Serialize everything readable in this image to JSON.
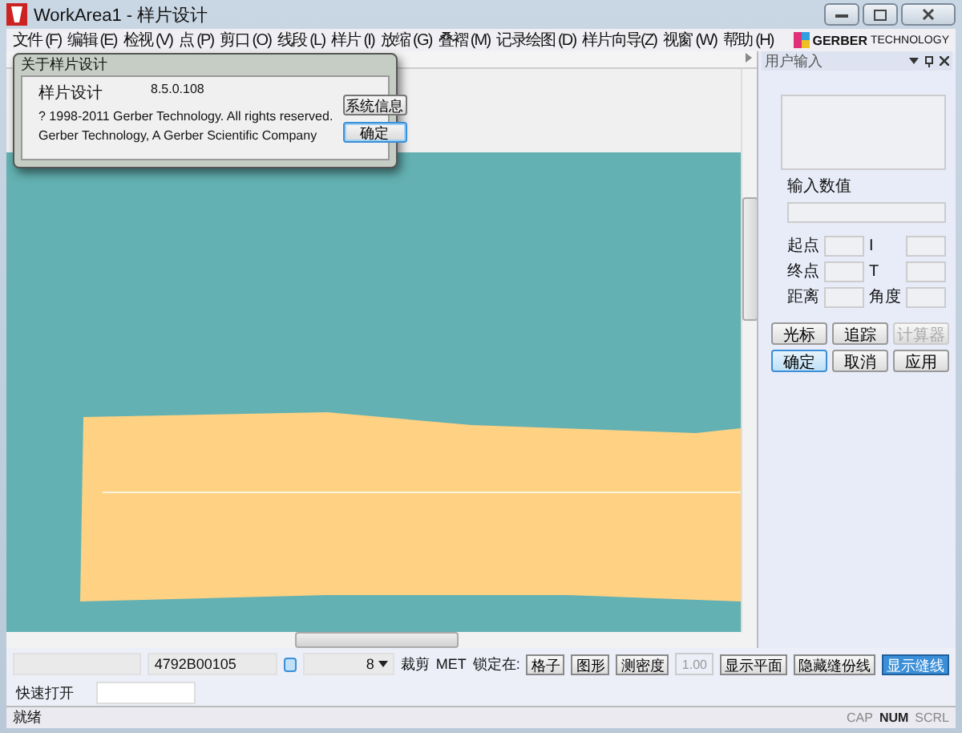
{
  "window": {
    "title": "WorkArea1 - 样片设计"
  },
  "menu": [
    "文件 (F)",
    "编辑 (E)",
    "检视 (V)",
    "点 (P)",
    "剪口 (O)",
    "线段 (L)",
    "样片 (I)",
    "放缩 (G)",
    "叠褶 (M)",
    "记录绘图 (D)",
    "样片向导(Z)",
    "视窗 (W)",
    "帮助 (H)"
  ],
  "brand": {
    "name": "GERBER",
    "suffix": "TECHNOLOGY"
  },
  "about_dialog": {
    "title": "关于样片设计",
    "product": "样片设计",
    "version": "8.5.0.108",
    "copyright": "? 1998-2011 Gerber Technology. All rights reserved.",
    "company": "Gerber Technology, A Gerber Scientific Company",
    "buttons": [
      {
        "label": "系统信息",
        "default": false
      },
      {
        "label": "确定",
        "default": true
      }
    ]
  },
  "user_input_panel": {
    "title": "用户输入",
    "input_label": "输入数值",
    "field_labels": [
      "起点",
      "I",
      "终点",
      "T",
      "距离",
      "角度"
    ],
    "button_rows": [
      [
        {
          "label": "光标",
          "disabled": false,
          "selected": false
        },
        {
          "label": "追踪",
          "disabled": false,
          "selected": false
        },
        {
          "label": "计算器",
          "disabled": true,
          "selected": false
        }
      ],
      [
        {
          "label": "确定",
          "disabled": false,
          "selected": true
        },
        {
          "label": "取消",
          "disabled": false,
          "selected": false
        },
        {
          "label": "应用",
          "disabled": false,
          "selected": false
        }
      ]
    ]
  },
  "toolbar": {
    "piece_code": "4792B00105",
    "size": "8",
    "cut_label": "裁剪",
    "unit": "MET",
    "lock_label": "锁定在:",
    "lock_buttons": [
      "格子",
      "图形",
      "测密度"
    ],
    "value": "1.00",
    "toggles": [
      {
        "label": "显示平面",
        "selected": false
      },
      {
        "label": "隐藏缝份线",
        "selected": false
      },
      {
        "label": "显示缝线",
        "selected": true
      }
    ]
  },
  "quick_open": {
    "label": "快速打开"
  },
  "status_bar": {
    "text": "就绪",
    "indicators": [
      {
        "label": "CAP",
        "on": false
      },
      {
        "label": "NUM",
        "on": true
      },
      {
        "label": "SCRL",
        "on": false
      }
    ]
  }
}
